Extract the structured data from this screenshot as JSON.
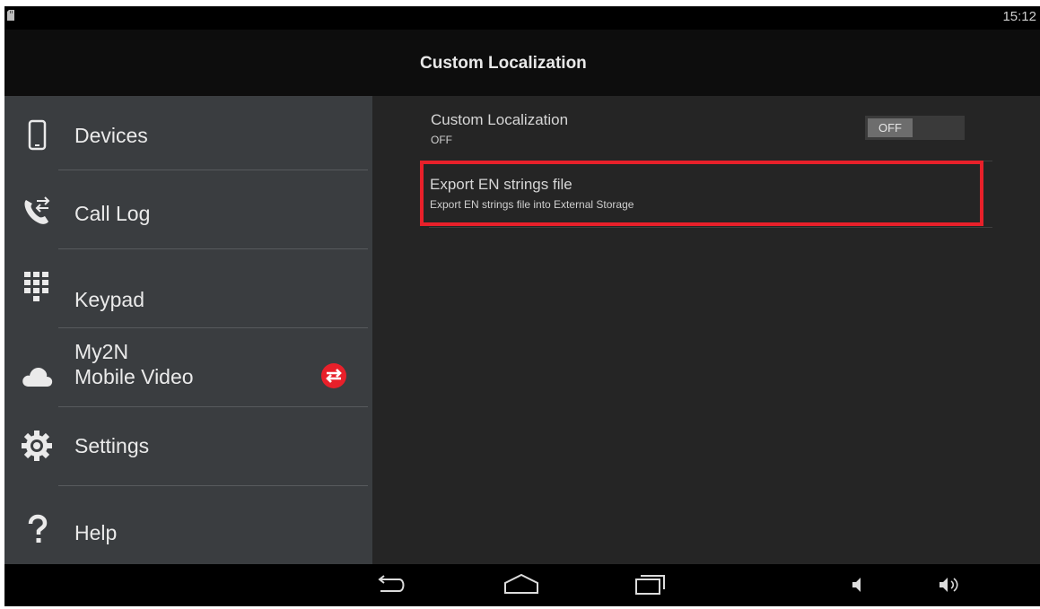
{
  "status_bar": {
    "time": "15:12"
  },
  "action_bar": {
    "title": "Custom Localization"
  },
  "drawer": {
    "items": [
      {
        "label": "Devices",
        "icon": "phone-device-icon"
      },
      {
        "label": "Call Log",
        "icon": "call-log-icon"
      },
      {
        "label": "Keypad",
        "icon": "keypad-icon"
      },
      {
        "label_line1": "My2N",
        "label_line2": "Mobile Video",
        "icon": "cloud-icon",
        "badge_icon": "sync-badge-icon",
        "badge_color": "#e8202a"
      },
      {
        "label": "Settings",
        "icon": "gear-icon"
      },
      {
        "label": "Help",
        "icon": "question-icon"
      }
    ]
  },
  "content": {
    "prefs": [
      {
        "title": "Custom Localization",
        "summary": "OFF",
        "toggle": {
          "state_label": "OFF"
        }
      },
      {
        "title": "Export EN strings file",
        "summary": "Export EN strings file into External Storage",
        "highlight_color": "#e8202a"
      }
    ]
  },
  "nav_bar": {
    "buttons": [
      "back-icon",
      "home-icon",
      "recents-icon"
    ],
    "right_icons": [
      "volume-down-icon",
      "volume-up-icon"
    ]
  }
}
